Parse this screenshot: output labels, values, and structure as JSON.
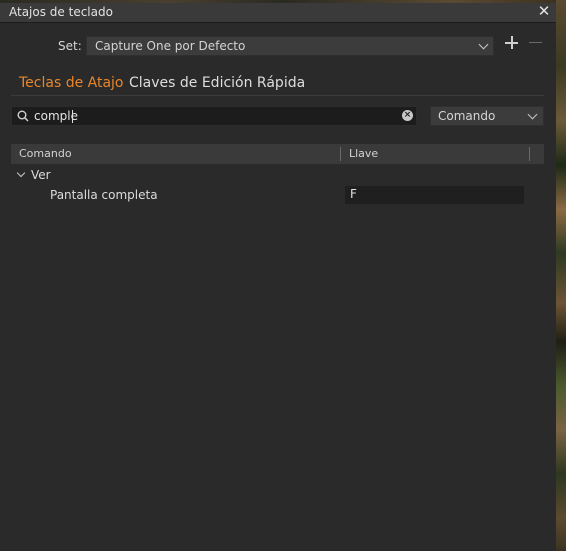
{
  "window": {
    "title": "Atajos de teclado"
  },
  "set": {
    "label": "Set:",
    "value": "Capture One por Defecto"
  },
  "tabs": [
    {
      "label": "Teclas de Atajo",
      "active": true
    },
    {
      "label": "Claves de Edición Rápida",
      "active": false
    }
  ],
  "search": {
    "value": "comple",
    "placeholder": ""
  },
  "search_mode": {
    "value": "Comando"
  },
  "table": {
    "columns": [
      "Comando",
      "Llave"
    ],
    "groups": [
      {
        "label": "Ver",
        "expanded": true,
        "items": [
          {
            "command": "Pantalla completa",
            "key": "F"
          }
        ]
      }
    ]
  },
  "colors": {
    "accent": "#e8862a",
    "background": "#2a2a2a",
    "titlebar": "#3a3a3a"
  },
  "icons": [
    "close-icon",
    "chevron-down-icon",
    "plus-icon",
    "minus-icon",
    "search-icon",
    "clear-icon"
  ]
}
